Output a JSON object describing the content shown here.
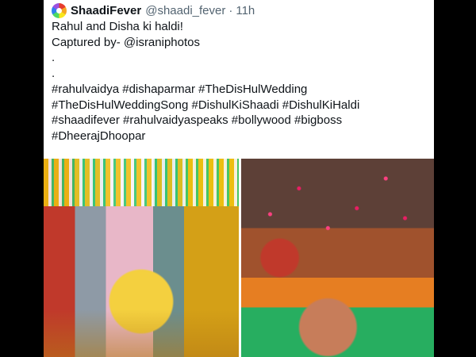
{
  "tweet": {
    "display_name": "ShaadiFever",
    "handle": "@shaadi_fever",
    "separator": "·",
    "time": "11h",
    "avatar_icon": "rainbow-circle-logo",
    "lines": [
      "Rahul and Disha ki haldi!",
      "Captured by- @israniphotos",
      ".",
      ".",
      "#rahulvaidya #dishaparmar #TheDisHulWedding",
      "#TheDisHulWeddingSong #DishulKiShaadi #DishulKiHaldi",
      "#shaadifever #rahulvaidyaspeaks #bollywood #bigboss",
      "#DheerajDhoopar"
    ]
  },
  "colors": {
    "text_primary": "#0f1419",
    "text_secondary": "#536471",
    "page_background": "#000000",
    "card_background": "#ffffff"
  }
}
